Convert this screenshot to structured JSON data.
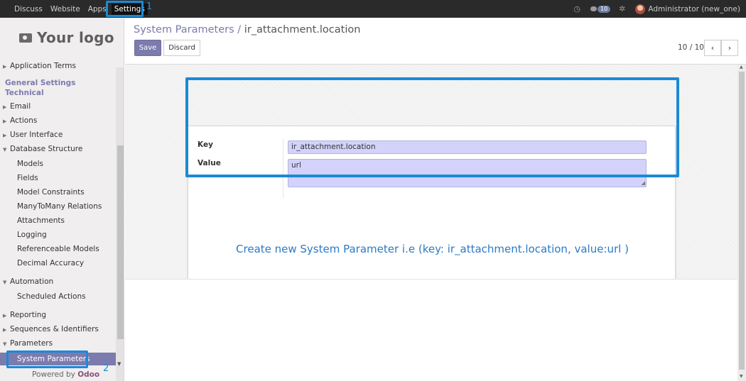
{
  "topnav": {
    "menu": [
      "Discuss",
      "Website",
      "Apps",
      "Settings"
    ],
    "active_index": 3,
    "message_count": "10",
    "user": "Administrator (new_one)"
  },
  "callouts": {
    "one": "1",
    "two": "2"
  },
  "sidebar": {
    "logo_text": "Your logo",
    "items": [
      {
        "label": "Application Terms",
        "kind": "collapsed"
      },
      {
        "label": "General Settings",
        "kind": "head"
      },
      {
        "label": "Technical",
        "kind": "head"
      },
      {
        "label": "Email",
        "kind": "collapsed"
      },
      {
        "label": "Actions",
        "kind": "collapsed"
      },
      {
        "label": "User Interface",
        "kind": "collapsed"
      },
      {
        "label": "Database Structure",
        "kind": "expanded"
      },
      {
        "label": "Models",
        "kind": "sub"
      },
      {
        "label": "Fields",
        "kind": "sub"
      },
      {
        "label": "Model Constraints",
        "kind": "sub"
      },
      {
        "label": "ManyToMany Relations",
        "kind": "sub"
      },
      {
        "label": "Attachments",
        "kind": "sub"
      },
      {
        "label": "Logging",
        "kind": "sub"
      },
      {
        "label": "Referenceable Models",
        "kind": "sub"
      },
      {
        "label": "Decimal Accuracy",
        "kind": "sub"
      },
      {
        "label": "Automation",
        "kind": "expanded"
      },
      {
        "label": "Scheduled Actions",
        "kind": "sub"
      },
      {
        "label": "Reporting",
        "kind": "collapsed"
      },
      {
        "label": "Sequences & Identifiers",
        "kind": "collapsed"
      },
      {
        "label": "Parameters",
        "kind": "expanded"
      },
      {
        "label": "System Parameters",
        "kind": "selected"
      }
    ],
    "powered_by": "Powered by",
    "powered_brand": "Odoo"
  },
  "breadcrumb": {
    "parent": "System Parameters",
    "separator": "/",
    "current": "ir_attachment.location"
  },
  "buttons": {
    "save": "Save",
    "discard": "Discard"
  },
  "pager": {
    "text": "10 / 10",
    "prev": "‹",
    "next": "›"
  },
  "form": {
    "key_label": "Key",
    "key_value": "ir_attachment.location",
    "value_label": "Value",
    "value_value": "url"
  },
  "annotation": "Create new System Parameter i.e (key: ir_attachment.location, value:url )",
  "colors": {
    "accent": "#7c7bad",
    "callout": "#1a8ad6",
    "field_bg": "#d2d2fa",
    "topbar": "#2a2a2a"
  }
}
